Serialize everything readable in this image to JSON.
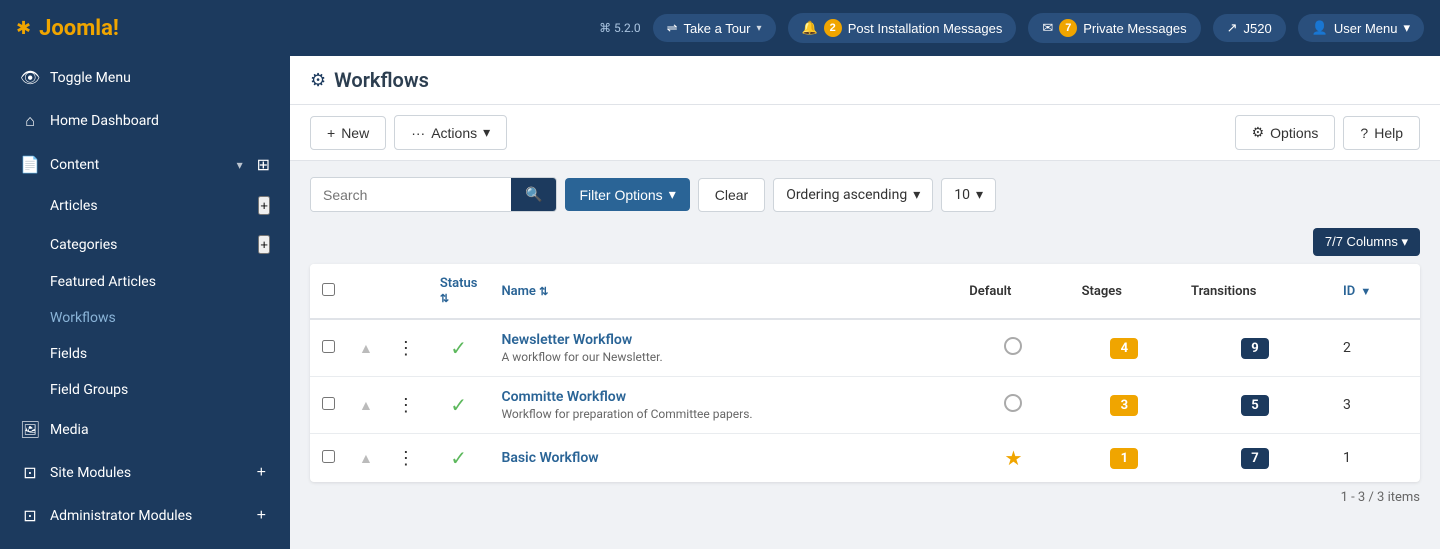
{
  "topnav": {
    "logo": "Joomla!",
    "version": "⌘ 5.2.0",
    "take_tour_label": "Take a Tour",
    "post_install_count": "2",
    "post_install_label": "Post Installation Messages",
    "private_msg_count": "7",
    "private_msg_label": "Private Messages",
    "site_label": "J520",
    "user_menu_label": "User Menu"
  },
  "sidebar": {
    "toggle_label": "Toggle Menu",
    "home_label": "Home Dashboard",
    "content_label": "Content",
    "articles_label": "Articles",
    "categories_label": "Categories",
    "featured_label": "Featured Articles",
    "workflows_label": "Workflows",
    "fields_label": "Fields",
    "field_groups_label": "Field Groups",
    "media_label": "Media",
    "site_modules_label": "Site Modules",
    "admin_modules_label": "Administrator Modules"
  },
  "toolbar": {
    "new_label": "New",
    "actions_label": "Actions",
    "options_label": "Options",
    "help_label": "Help"
  },
  "page": {
    "title": "Workflows"
  },
  "filter": {
    "search_placeholder": "Search",
    "filter_options_label": "Filter Options",
    "clear_label": "Clear",
    "ordering_label": "Ordering ascending",
    "per_page_value": "10",
    "columns_label": "7/7 Columns ▾"
  },
  "table": {
    "col_status": "Status",
    "col_name": "Name",
    "col_default": "Default",
    "col_stages": "Stages",
    "col_transitions": "Transitions",
    "col_id": "ID",
    "rows": [
      {
        "id": 2,
        "name": "Newsletter Workflow",
        "description": "A workflow for our Newsletter.",
        "status": "published",
        "default": false,
        "stages": 4,
        "transitions": 9
      },
      {
        "id": 3,
        "name": "Committe Workflow",
        "description": "Workflow for preparation of Committee papers.",
        "status": "published",
        "default": false,
        "stages": 3,
        "transitions": 5
      },
      {
        "id": 1,
        "name": "Basic Workflow",
        "description": "",
        "status": "published",
        "default": true,
        "stages": 1,
        "transitions": 7
      }
    ],
    "pagination": "1 - 3 / 3 items"
  }
}
